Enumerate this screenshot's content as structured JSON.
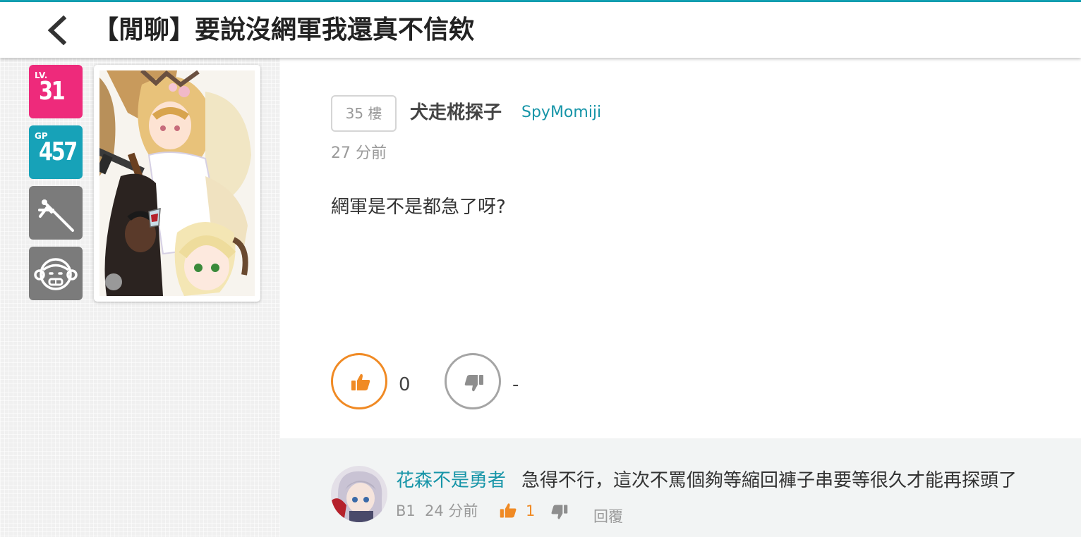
{
  "header": {
    "title": "【閒聊】要說沒網軍我還真不信欸"
  },
  "sidebar": {
    "level_tag": "LV.",
    "level": "31",
    "gp_tag": "GP",
    "gp": "457",
    "badge_icons": [
      "tools-icon",
      "monkey-face-icon"
    ]
  },
  "post": {
    "floor": "35 樓",
    "username": "犬走椛探子",
    "user_id": "SpyMomiji",
    "time": "27 分前",
    "content": "網軍是不是都急了呀?",
    "upvotes": "0",
    "downvotes": "-"
  },
  "reply": {
    "name": "花森不是勇者",
    "text": "急得不行，這次不罵個夠等縮回褲子串要等很久才能再探頭了",
    "floor": "B1",
    "time": "24 分前",
    "upvotes": "1",
    "reply_label": "回覆"
  },
  "colors": {
    "accent": "#13a0b2",
    "level_badge": "#ee2a7b",
    "gp_badge": "#17a2b8",
    "upvote": "#f08a24",
    "downvote": "#a5a5a5",
    "link": "#1795a8"
  }
}
